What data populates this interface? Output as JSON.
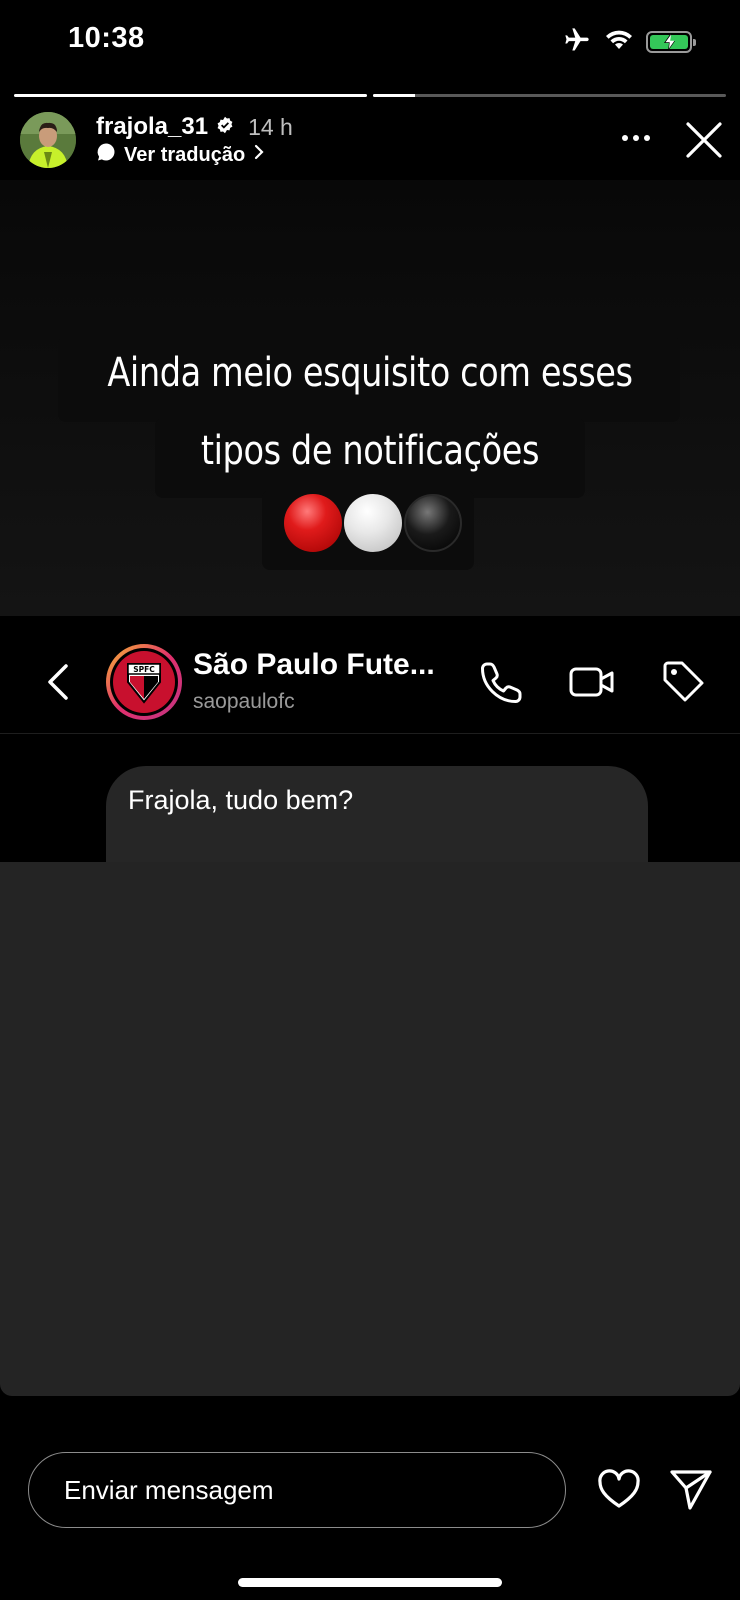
{
  "status_bar": {
    "time": "10:38",
    "icons": [
      "airplane-icon",
      "wifi-icon",
      "battery-charging-icon"
    ]
  },
  "story": {
    "progress": [
      1.0,
      0.12
    ],
    "username": "frajola_31",
    "verified": true,
    "time_ago": "14 h",
    "translate_label": "Ver tradução",
    "caption_line1": "Ainda meio esquisito com esses",
    "caption_line2": "tipos de notificações",
    "emojis": [
      "red-circle",
      "white-circle",
      "black-circle"
    ]
  },
  "dm": {
    "name": "São Paulo Fute...",
    "handle": "saopaulofc",
    "crest_text": "SPFC",
    "message": "Frajola, tudo bem?",
    "icons": [
      "back-chevron-icon",
      "phone-icon",
      "video-camera-icon",
      "tag-icon"
    ]
  },
  "reply": {
    "placeholder": "Enviar mensagem",
    "icons": [
      "heart-icon",
      "send-icon"
    ]
  },
  "colors": {
    "background": "#000000",
    "battery_green": "#34c759",
    "spfc_red": "#c8102e",
    "bubble": "#262626",
    "story_overlay": "#242424"
  }
}
